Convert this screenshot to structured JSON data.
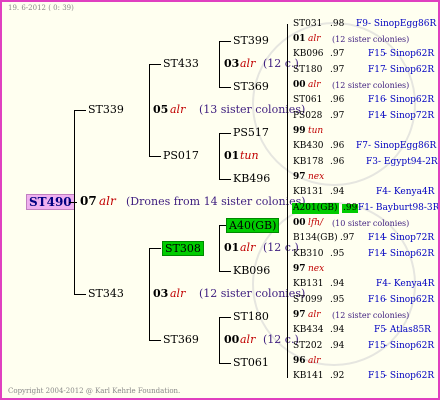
{
  "header": {
    "date": "19.  6-2012 (  0: 39)"
  },
  "root": {
    "id": "ST490",
    "year": "07",
    "origin": "alr",
    "note": "(Drones from 14 sister colonies)"
  },
  "gen1": [
    {
      "id": "ST339",
      "year": "05",
      "origin": "alr",
      "note": "(13 sister colonies)"
    },
    {
      "id": "ST343",
      "year": "03",
      "origin": "alr",
      "note": "(12 sister colonies)"
    }
  ],
  "gen2": [
    {
      "id": "ST433",
      "year": "03",
      "origin": "alr",
      "note": "(12 c.)"
    },
    {
      "id": "PS017",
      "year": "01",
      "origin": "tun",
      "note": ""
    },
    {
      "id": "ST308",
      "year": "01",
      "origin": "alr",
      "note": "(12 c.)"
    },
    {
      "id": "ST369",
      "year": "00",
      "origin": "alr",
      "note": "(12 c.)"
    }
  ],
  "gen3": [
    "ST399",
    "ST369",
    "PS517",
    "KB496",
    "A40(GB)",
    "KB096",
    "ST180",
    "ST061"
  ],
  "gen4": [
    {
      "id": "ST031",
      "year": ".98",
      "code": "F9",
      "line": "- SinopEgg86R"
    },
    {
      "year": "01",
      "origin": "alr",
      "note": "(12 sister colonies)"
    },
    {
      "id": "KB096",
      "year": ".97",
      "code": "F15",
      "line": "- Sinop62R"
    },
    {
      "id": "ST180",
      "year": ".97",
      "code": "F17",
      "line": "- Sinop62R"
    },
    {
      "year": "00",
      "origin": "alr",
      "note": "(12 sister colonies)"
    },
    {
      "id": "ST061",
      "year": ".96",
      "code": "F16",
      "line": "- Sinop62R"
    },
    {
      "id": "PS028",
      "year": ".97",
      "code": "F14",
      "line": "- Sinop72R"
    },
    {
      "year": "99",
      "origin": "tun",
      "note": ""
    },
    {
      "id": "KB430",
      "year": ".96",
      "code": "F7",
      "line": "- SinopEgg86R"
    },
    {
      "id": "KB178",
      "year": ".96",
      "code": "F3",
      "line": "- Egypt94-2R"
    },
    {
      "year": "97",
      "origin": "nex",
      "note": ""
    },
    {
      "id": "KB131",
      "year": ".94",
      "code": "F4",
      "line": "- Kenya4R"
    },
    {
      "id": "A201(GB)",
      "year": ".99",
      "code": "F1",
      "line": "- Bayburt98-3R"
    },
    {
      "year": "00",
      "origin": "lfh/",
      "note": "(10 sister colonies)"
    },
    {
      "id": "B134(GB)",
      "year": ".97",
      "code": "F14",
      "line": "- Sinop72R"
    },
    {
      "id": "KB310",
      "year": ".95",
      "code": "F14",
      "line": "- Sinop62R"
    },
    {
      "year": "97",
      "origin": "nex",
      "note": ""
    },
    {
      "id": "KB131",
      "year": ".94",
      "code": "F4",
      "line": "- Kenya4R"
    },
    {
      "id": "ST099",
      "year": ".95",
      "code": "F16",
      "line": "- Sinop62R"
    },
    {
      "year": "97",
      "origin": "alr",
      "note": "(12 sister colonies)"
    },
    {
      "id": "KB434",
      "year": ".94",
      "code": "F5",
      "line": "- Atlas85R"
    },
    {
      "id": "ST202",
      "year": ".94",
      "code": "F15",
      "line": "- Sinop62R"
    },
    {
      "year": "96",
      "origin": "alr",
      "note": ""
    },
    {
      "id": "KB141",
      "year": ".92",
      "code": "F15",
      "line": "- Sinop62R"
    }
  ],
  "footer": {
    "copyright": "Copyright 2004-2012 @ Karl Kehrle Foundation."
  },
  "colors": {
    "frame": "#e040c0",
    "root_bg": "#f0b0f0",
    "green": "#00cc00",
    "red": "#c00000",
    "blue": "#0000c0"
  }
}
